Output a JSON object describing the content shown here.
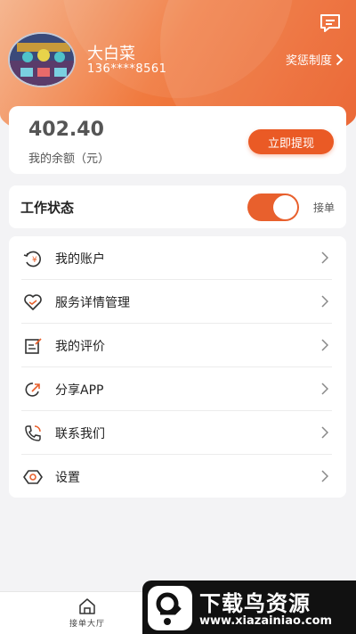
{
  "header": {
    "user_name": "大白菜",
    "user_phone": "136****8561",
    "rules_link": "奖惩制度",
    "message_icon": "message-icon"
  },
  "balance": {
    "amount": "402.40",
    "label": "我的余额（元）",
    "withdraw_button": "立即提现"
  },
  "work_status": {
    "label": "工作状态",
    "toggle_on": true,
    "value": "接单"
  },
  "menu": {
    "items": [
      {
        "label": "我的账户",
        "icon": "account-icon"
      },
      {
        "label": "服务详情管理",
        "icon": "heart-icon"
      },
      {
        "label": "我的评价",
        "icon": "review-icon"
      },
      {
        "label": "分享APP",
        "icon": "share-icon"
      },
      {
        "label": "联系我们",
        "icon": "phone-icon"
      },
      {
        "label": "设置",
        "icon": "settings-icon"
      }
    ]
  },
  "bottom_nav": {
    "tab_hall": "接单大厅"
  },
  "watermark": {
    "title": "下载鸟资源",
    "url": "www.xiazainiao.com"
  },
  "colors": {
    "accent": "#ea5a25",
    "header_gradient_start": "#f5b690",
    "header_gradient_end": "#e8561f"
  }
}
